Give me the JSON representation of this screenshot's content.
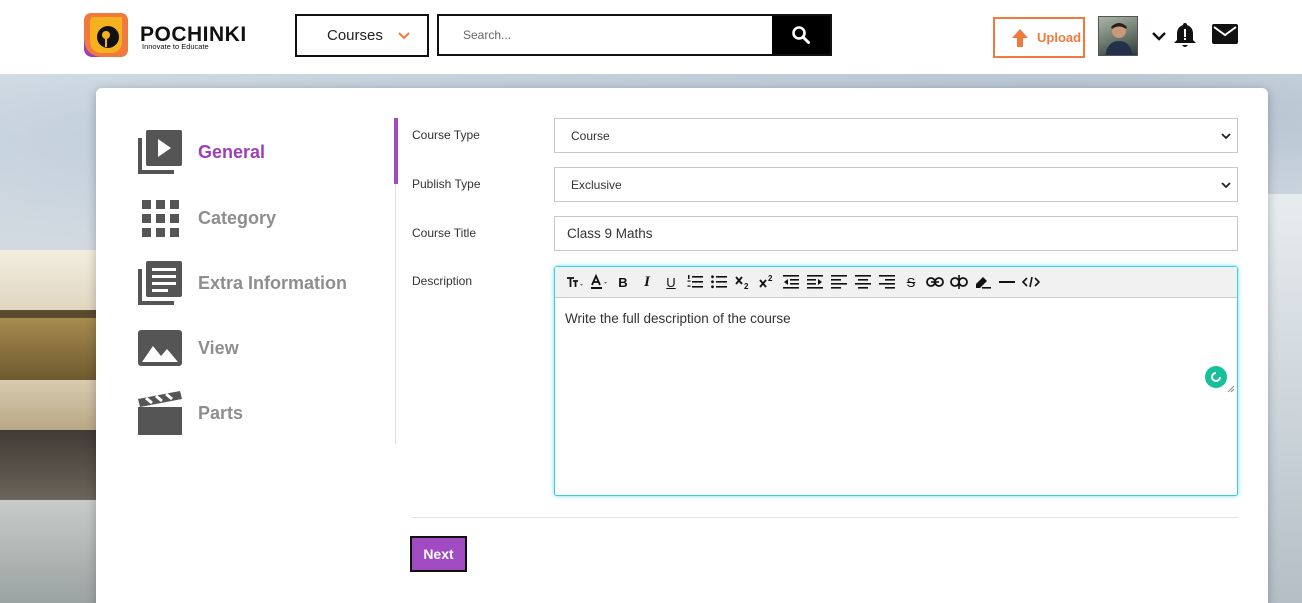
{
  "header": {
    "logo_name": "POCHINKI",
    "logo_tagline": "Innovate to Educate",
    "category_select": "Courses",
    "search_placeholder": "Search...",
    "upload_label": "Upload"
  },
  "sidebar": {
    "items": [
      {
        "label": "General",
        "icon": "video-library-icon",
        "active": true
      },
      {
        "label": "Category",
        "icon": "grid-icon",
        "active": false
      },
      {
        "label": "Extra Information",
        "icon": "library-books-icon",
        "active": false
      },
      {
        "label": "View",
        "icon": "image-icon",
        "active": false
      },
      {
        "label": "Parts",
        "icon": "clapperboard-icon",
        "active": false
      }
    ]
  },
  "form": {
    "course_type": {
      "label": "Course Type",
      "value": "Course"
    },
    "publish_type": {
      "label": "Publish Type",
      "value": "Exclusive"
    },
    "course_title": {
      "label": "Course Title",
      "value": "Class 9 Maths"
    },
    "description": {
      "label": "Description",
      "value": "Write the full description of the course"
    },
    "next_label": "Next"
  },
  "colors": {
    "accent": "#a04bc1",
    "upload": "#f07a3e",
    "editor_focus": "#3ccbe6",
    "grammarly": "#16c19a"
  }
}
